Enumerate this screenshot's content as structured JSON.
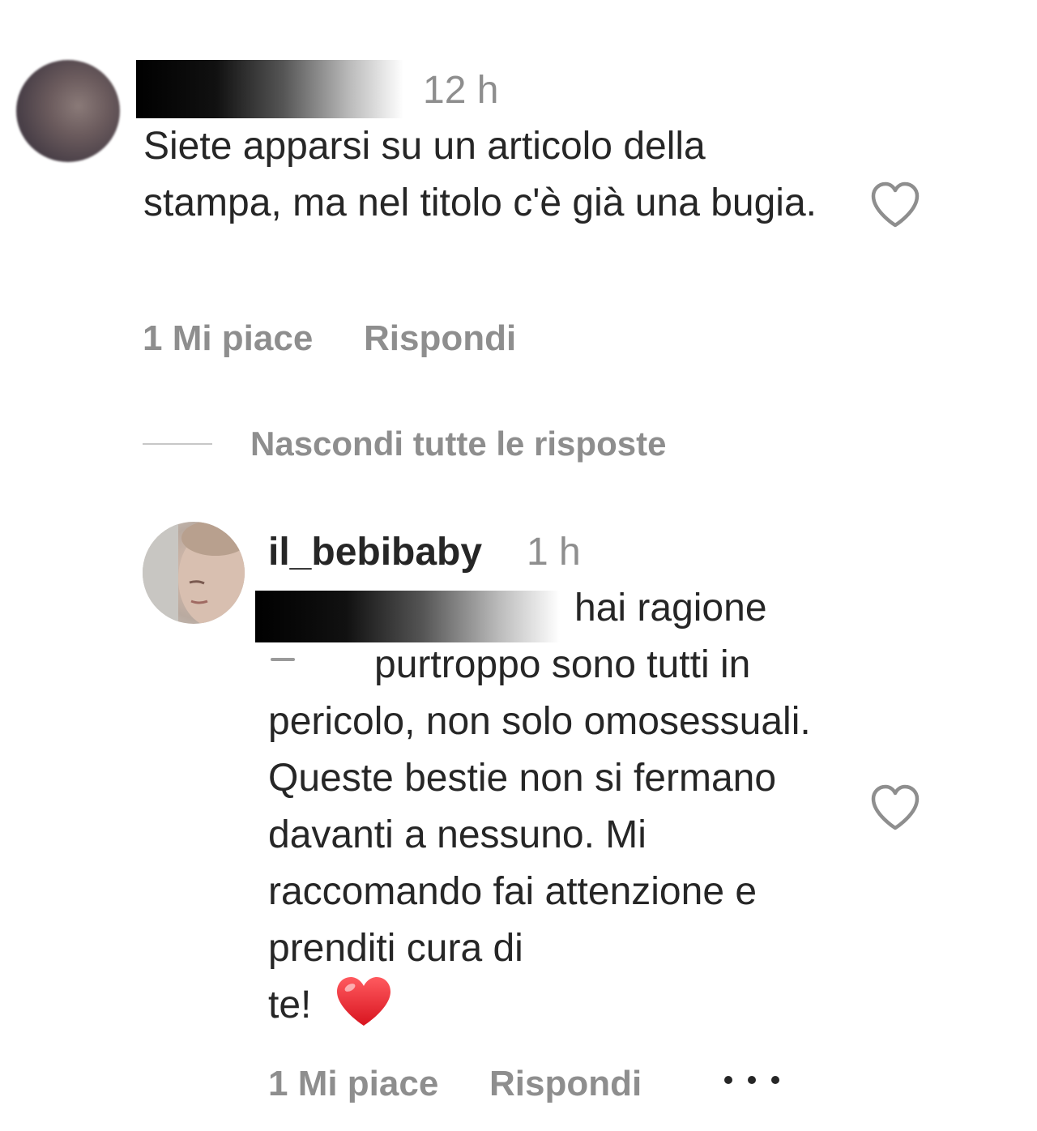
{
  "comment": {
    "time": "12 h",
    "text": "Siete apparsi su un articolo della stampa, ma nel titolo c'è già una bugia.",
    "likes": "1 Mi piace",
    "reply_label": "Rispondi",
    "like_icon": "heart-outline-icon"
  },
  "replies_toggle": {
    "label": "Nascondi tutte le risposte"
  },
  "reply": {
    "username": "il_bebibaby",
    "time": "1 h",
    "text_line1": "hai ragione",
    "text_line2": "purtroppo sono tutti in",
    "text_rest": "pericolo, non solo omosessuali. Queste bestie non si fermano davanti a nessuno. Mi raccomando fai attenzione e prenditi cura di",
    "text_end": "te!",
    "emoji": "❤️",
    "likes": "1 Mi piace",
    "reply_label": "Rispondi",
    "like_icon": "heart-outline-icon",
    "more_icon": "more-options-icon"
  },
  "colors": {
    "text": "#262626",
    "secondary": "#8e8e8e",
    "heart_emoji": "#e0202c"
  }
}
